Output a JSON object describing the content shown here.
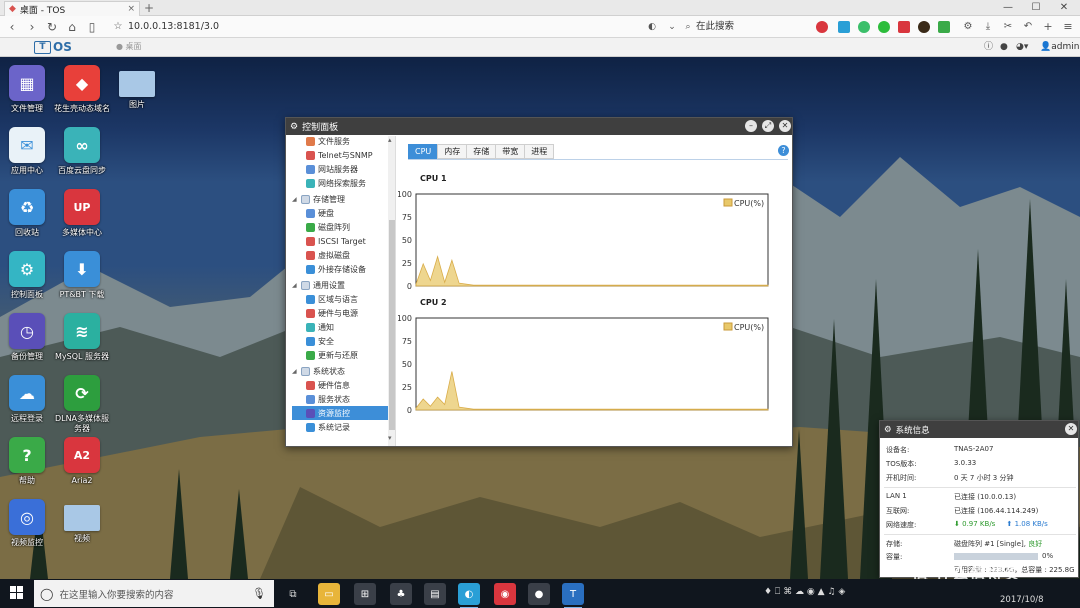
{
  "browser": {
    "tab_title": "桌面 - TOS",
    "url": "10.0.0.13:8181/3.0",
    "search_placeholder": "在此搜索"
  },
  "tos_bar": {
    "logo_text": "OS",
    "logo_box": "T",
    "desktop_btn": "桌面",
    "user": "admin"
  },
  "desktop_icons": [
    {
      "label": "文件管理",
      "icon": "file-manager-icon",
      "color": "#6b64c9"
    },
    {
      "label": "花生壳动态域名",
      "icon": "peanut-hull-icon",
      "color": "#e8403a"
    },
    {
      "label": "图片",
      "icon": "folder-icon",
      "color": "#a9c8e6"
    },
    {
      "label": "应用中心",
      "icon": "app-center-icon",
      "color": "#e9f2f8"
    },
    {
      "label": "百度云盘同步",
      "icon": "baidu-cloud-icon",
      "color": "#3ab3b8"
    },
    {
      "label": "回收站",
      "icon": "recycle-bin-icon",
      "color": "#3a8fd8"
    },
    {
      "label": "多媒体中心",
      "icon": "upnp-icon",
      "color": "#d9363e"
    },
    {
      "label": "控制面板",
      "icon": "control-panel-icon",
      "color": "#34b5c4"
    },
    {
      "label": "PT&BT 下载",
      "icon": "download-icon",
      "color": "#3a8fd8"
    },
    {
      "label": "备份管理",
      "icon": "backup-icon",
      "color": "#5a4fb8"
    },
    {
      "label": "MySQL 服务器",
      "icon": "mysql-icon",
      "color": "#2bb0a0"
    },
    {
      "label": "远程登录",
      "icon": "cloud-icon",
      "color": "#3a8fd8"
    },
    {
      "label": "DLNA多媒体服务器",
      "icon": "dlna-icon",
      "color": "#2d9e3e"
    },
    {
      "label": "帮助",
      "icon": "help-icon",
      "color": "#3aaa48"
    },
    {
      "label": "Aria2",
      "icon": "aria2-icon",
      "color": "#d9363e"
    },
    {
      "label": "视频监控",
      "icon": "video-monitor-icon",
      "color": "#3a6fd8"
    },
    {
      "label": "视频",
      "icon": "folder-icon",
      "color": "#a9c8e6"
    }
  ],
  "control_panel": {
    "title": "控制面板",
    "sidebar": [
      {
        "label": "文件服务",
        "kind": "item",
        "color": "#e07a4a"
      },
      {
        "label": "Telnet与SNMP",
        "kind": "item",
        "color": "#d9534f"
      },
      {
        "label": "网站服务器",
        "kind": "item",
        "color": "#5a8fd8"
      },
      {
        "label": "网络探索服务",
        "kind": "item",
        "color": "#3ab3b8"
      },
      {
        "label": "存储管理",
        "kind": "category"
      },
      {
        "label": "硬盘",
        "kind": "item",
        "color": "#5a8fd8"
      },
      {
        "label": "磁盘阵列",
        "kind": "item",
        "color": "#3aaa48"
      },
      {
        "label": "ISCSI Target",
        "kind": "item",
        "color": "#d9534f"
      },
      {
        "label": "虚拟磁盘",
        "kind": "item",
        "color": "#d9534f"
      },
      {
        "label": "外接存储设备",
        "kind": "item",
        "color": "#3a8fd8"
      },
      {
        "label": "通用设置",
        "kind": "category"
      },
      {
        "label": "区域与语言",
        "kind": "item",
        "color": "#3a8fd8"
      },
      {
        "label": "硬件与电源",
        "kind": "item",
        "color": "#d9534f"
      },
      {
        "label": "通知",
        "kind": "item",
        "color": "#3ab3b8"
      },
      {
        "label": "安全",
        "kind": "item",
        "color": "#3a8fd8"
      },
      {
        "label": "更新与还原",
        "kind": "item",
        "color": "#3aaa48"
      },
      {
        "label": "系统状态",
        "kind": "category"
      },
      {
        "label": "硬件信息",
        "kind": "item",
        "color": "#d9534f"
      },
      {
        "label": "服务状态",
        "kind": "item",
        "color": "#5a8fd8"
      },
      {
        "label": "资源监控",
        "kind": "item",
        "color": "#5a4fb8",
        "active": true
      },
      {
        "label": "系统记录",
        "kind": "item",
        "color": "#3a8fd8"
      }
    ],
    "tabs": [
      "CPU",
      "内存",
      "存储",
      "带宽",
      "进程"
    ],
    "active_tab": "CPU"
  },
  "chart_data": [
    {
      "type": "area",
      "title": "CPU 1",
      "series": [
        {
          "name": "CPU(%)",
          "color": "#e8c86a",
          "values": [
            2,
            24,
            6,
            32,
            4,
            28,
            3,
            2,
            1,
            1,
            1,
            1,
            1,
            1,
            1,
            1,
            1,
            1,
            1,
            1,
            1,
            1,
            1,
            1,
            1,
            1,
            1,
            1,
            1,
            1,
            1,
            1,
            1,
            1,
            1,
            1,
            1,
            1,
            1,
            1,
            1,
            1,
            1,
            1,
            1,
            1,
            1,
            1,
            1,
            1
          ]
        }
      ],
      "yticks": [
        0,
        25,
        50,
        75,
        100
      ],
      "ylim": [
        0,
        100
      ]
    },
    {
      "type": "area",
      "title": "CPU 2",
      "series": [
        {
          "name": "CPU(%)",
          "color": "#e8c86a",
          "values": [
            2,
            12,
            4,
            14,
            6,
            42,
            3,
            2,
            1,
            1,
            1,
            1,
            1,
            1,
            1,
            1,
            1,
            1,
            1,
            1,
            1,
            1,
            1,
            1,
            1,
            1,
            1,
            1,
            1,
            1,
            1,
            1,
            1,
            1,
            1,
            1,
            1,
            1,
            1,
            1,
            1,
            1,
            1,
            1,
            1,
            1,
            1,
            1,
            1,
            1
          ]
        }
      ],
      "yticks": [
        0,
        25,
        50,
        75,
        100
      ],
      "ylim": [
        0,
        100
      ]
    }
  ],
  "sysinfo": {
    "title": "系统信息",
    "device_name_k": "设备名:",
    "device_name_v": "TNAS-2A07",
    "tos_version_k": "TOS版本:",
    "tos_version_v": "3.0.33",
    "uptime_k": "开机时间:",
    "uptime_v": "0 天 7 小时 3 分钟",
    "lan1_k": "LAN 1",
    "lan1_v": "已连接 (10.0.0.13)",
    "internet_k": "互联网:",
    "internet_v": "已连接 (106.44.114.249)",
    "netspeed_k": "网络速度:",
    "net_down": "0.97 KB/s",
    "net_up": "1.08 KB/s",
    "storage_k": "存储:",
    "storage_v": "磁盘阵列 #1 [Single],",
    "storage_status": "良好",
    "capacity_k": "容量:",
    "capacity_pct": "0%",
    "capacity_fraction": 0.0,
    "capacity_detail": "可用容量 : 223.6G，总容量 : 225.8G"
  },
  "taskbar": {
    "search_placeholder": "在这里输入你要搜索的内容",
    "clock_date": "2017/10/8",
    "watermark": "值 什么值得买"
  }
}
